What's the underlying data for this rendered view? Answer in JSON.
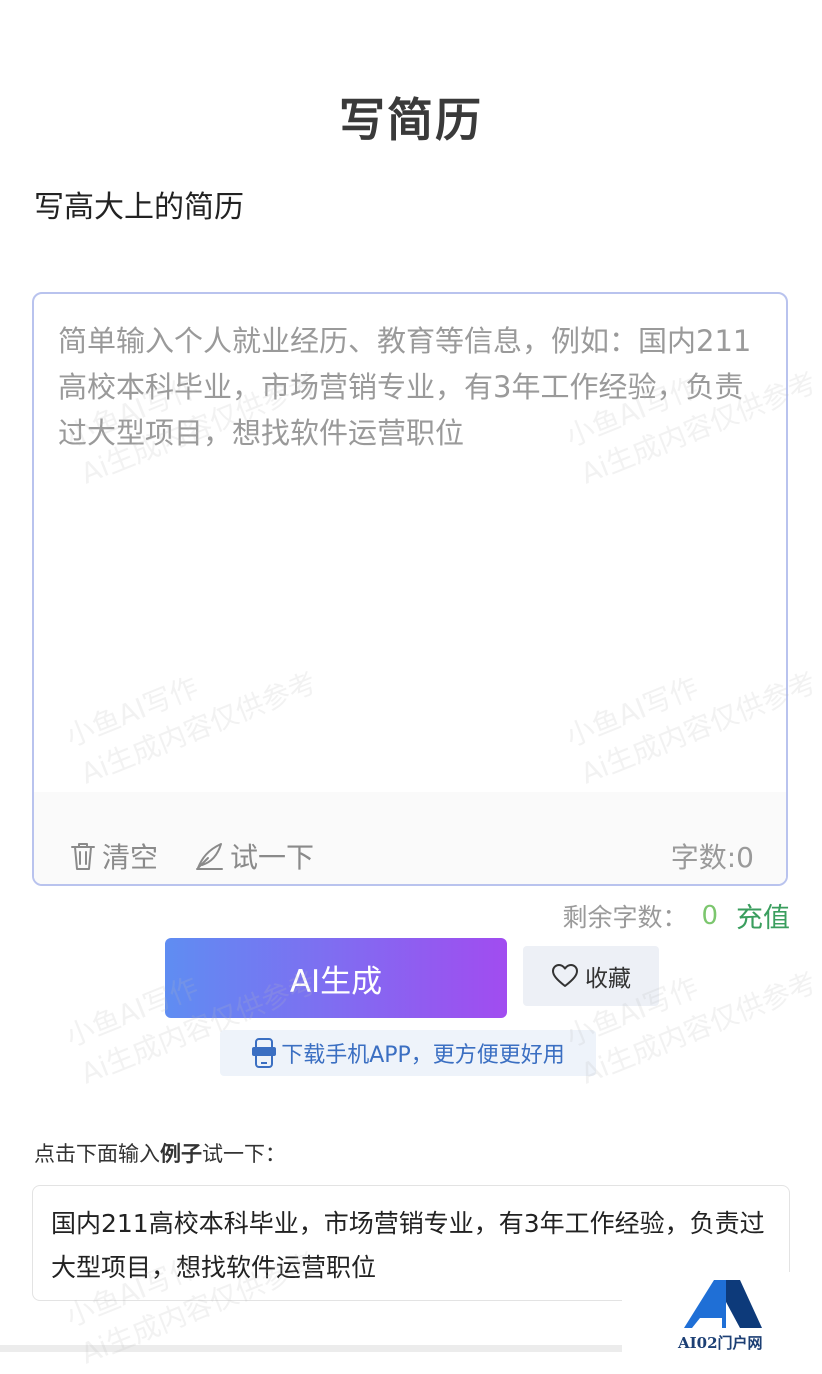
{
  "header": {
    "title": "写简历",
    "subtitle": "写高大上的简历"
  },
  "editor": {
    "placeholder": "简单输入个人就业经历、教育等信息，例如：国内211高校本科毕业，市场营销专业，有3年工作经验，负责过大型项目，想找软件运营职位",
    "value": "",
    "clear_label": "清空",
    "try_label": "试一下",
    "word_count_label": "字数:0"
  },
  "quota": {
    "label": "剩余字数：",
    "count": "0",
    "recharge_label": "充值"
  },
  "actions": {
    "generate_label": "AI生成",
    "favorite_label": "收藏",
    "app_download_label": "下载手机APP，更方便更好用"
  },
  "examples": {
    "hint_prefix": "点击下面输入",
    "hint_bold": "例子",
    "hint_suffix": "试一下：",
    "items": [
      "国内211高校本科毕业，市场营销专业，有3年工作经验，负责过大型项目，想找软件运营职位"
    ]
  },
  "watermark": {
    "line1": "小鱼AI写作",
    "line2": "Ai生成内容仅供参考"
  },
  "logo": {
    "text": "AI02门户网"
  },
  "colors": {
    "accent_start": "#5f8df2",
    "accent_end": "#a14cf0",
    "recharge": "#3a9e5e",
    "count": "#7cc66e",
    "editor_border": "#b9c3ee"
  },
  "icons": {
    "clear": "trash-icon",
    "try": "pen-icon",
    "favorite": "heart-icon",
    "app": "phone-app-icon"
  }
}
